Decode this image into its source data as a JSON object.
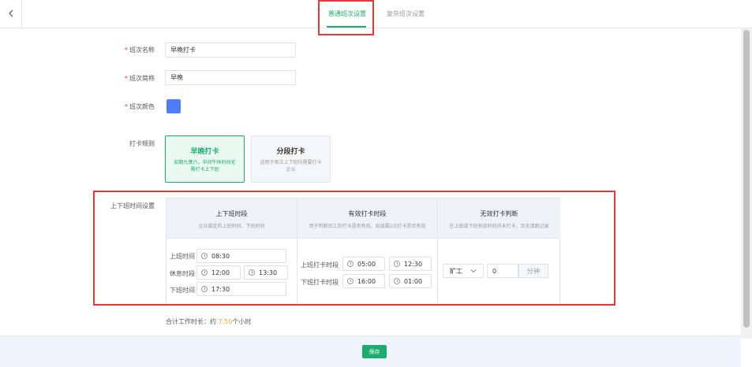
{
  "tabs": [
    {
      "label": "普通班次设置",
      "active": true
    },
    {
      "label": "复杂班次设置",
      "active": false
    }
  ],
  "form": {
    "name_label": "班次名称",
    "name_value": "早晚打卡",
    "short_label": "班次简称",
    "short_value": "早晚",
    "color_label": "班次颜色",
    "color_value": "#4f7df9",
    "rule_label": "打卡规则",
    "cards": [
      {
        "title": "早晚打卡",
        "desc": "如朝九晚六，中间午休时间无需打卡上下班",
        "active": true
      },
      {
        "title": "分段打卡",
        "desc": "适用于每次上下班均需要打卡企业",
        "active": false
      }
    ],
    "time_label": "上下班时间设置"
  },
  "time_table": {
    "col1": {
      "title": "上下班时段",
      "subtitle": "企业规定的上班时间、下班时间",
      "work_label": "上班时间",
      "work_time": "08:30",
      "rest_label": "休息时段",
      "rest_start": "12:00",
      "rest_end": "13:30",
      "off_label": "下班时间",
      "off_time": "17:30"
    },
    "col2": {
      "title": "有效打卡时段",
      "subtitle": "用于判断员工的打卡是否有效，如凌晨2点打卡是否有效",
      "in_label": "上班打卡时段",
      "in_start": "05:00",
      "in_end": "12:30",
      "out_label": "下班打卡时段",
      "out_start": "16:00",
      "out_end": "01:00"
    },
    "col3": {
      "title": "无效打卡判断",
      "subtitle": "在上班或下班有效时间内未打卡，且无请假记录",
      "select_value": "旷工",
      "minutes_value": "0",
      "unit": "分钟"
    }
  },
  "summary": {
    "prefix": "合计工作时长：约 ",
    "hours": "7.50",
    "suffix": "个小时"
  },
  "footer": {
    "save_label": "保存"
  },
  "colors": {
    "accent": "#1aad6d",
    "highlight": "#e53935"
  }
}
